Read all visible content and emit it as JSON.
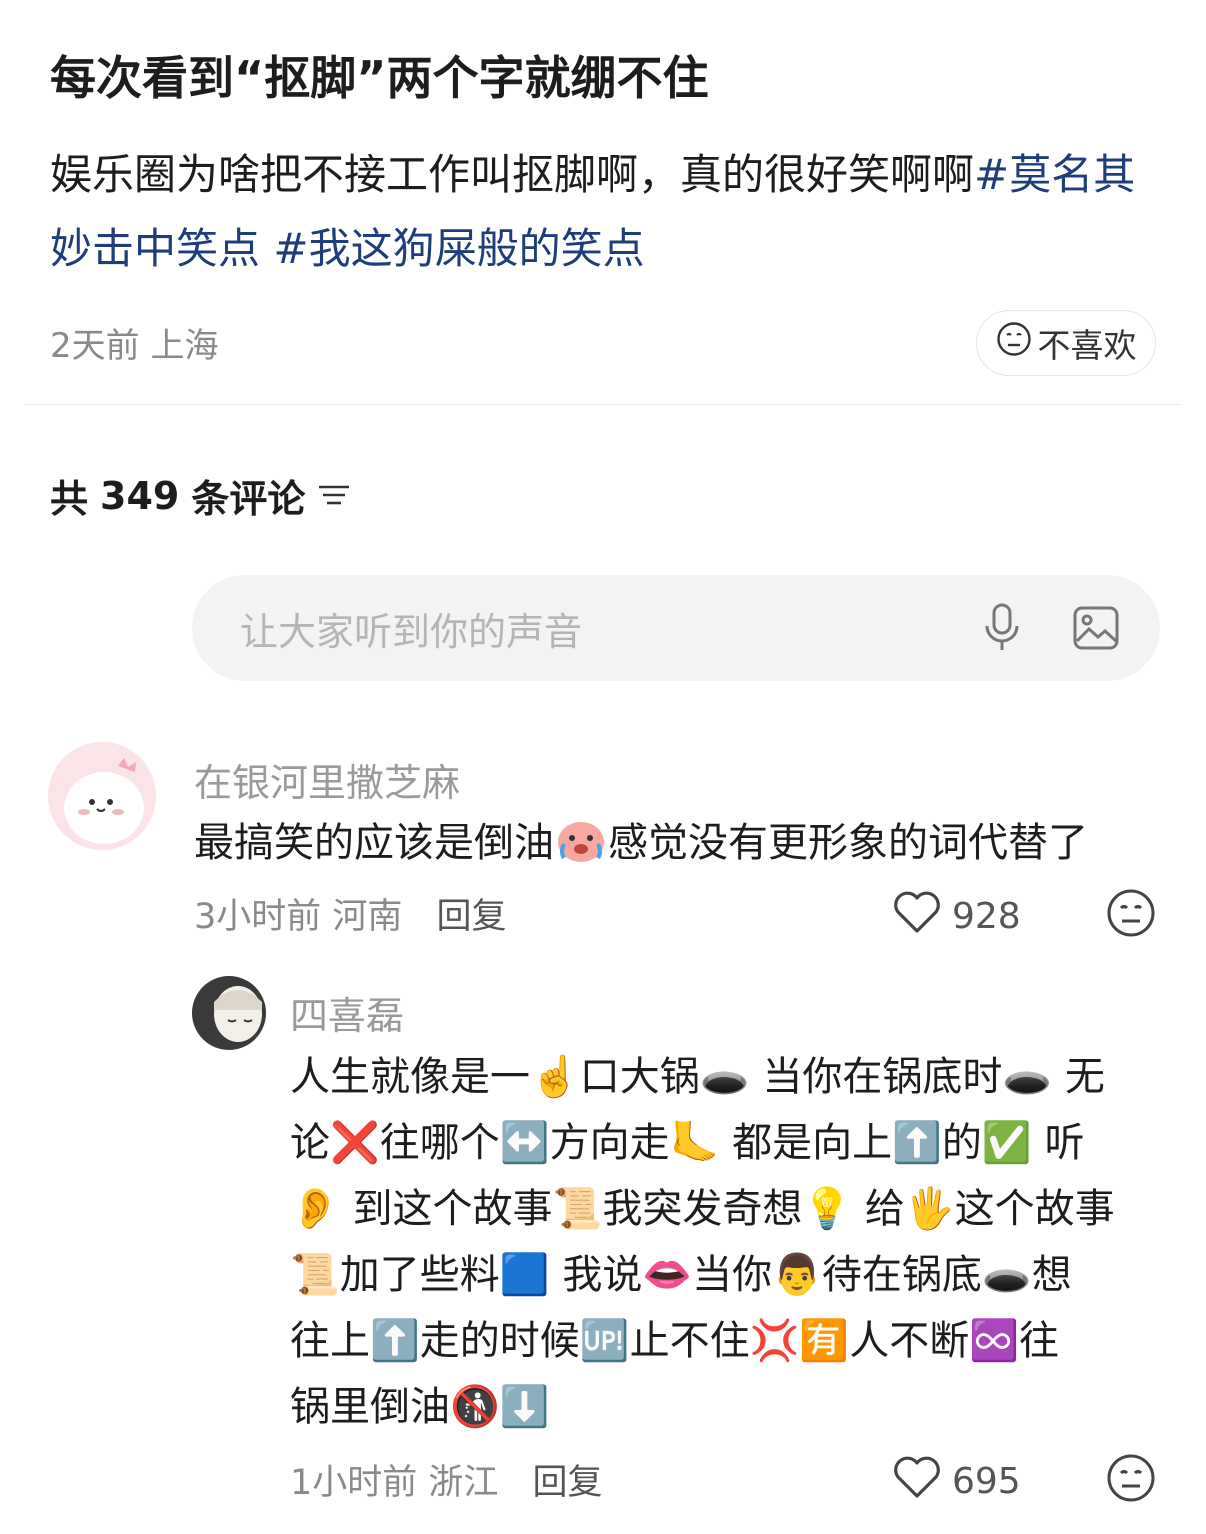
{
  "post": {
    "title": "每次看到“抠脚”两个字就绷不住",
    "body_text": "娱乐圈为啥把不接工作叫抠脚啊，真的很好笑啊啊",
    "tags": [
      "#莫名其妙击中笑点",
      "#我这狗屎般的笑点"
    ],
    "tag_prefix_hash": "#",
    "time": "2天前",
    "location": "上海",
    "dislike_label": "不喜欢"
  },
  "comments_header": {
    "prefix": "共",
    "count": "349",
    "suffix": "条评论"
  },
  "input": {
    "placeholder": "让大家听到你的声音"
  },
  "comments": [
    {
      "user": "在银河里撒芝麻",
      "text_part1": "最搞笑的应该是倒油",
      "text_part2": "感觉没有更形象的词代替了",
      "time": "3小时前",
      "location": "河南",
      "reply_label": "回复",
      "likes": "928"
    },
    {
      "user": "四喜磊",
      "lines": [
        "人生就像是一☝️口大锅🕳️ 当你在锅底时🕳️ 无",
        "论❌往哪个↔️方向走🦶 都是向上⬆️的✅ 听",
        "👂 到这个故事📜我突发奇想💡 给🖐️这个故事",
        "📜加了些料🟦 我说👄当你👨待在锅底🕳️想",
        "往上⬆️走的时候🆙止不住💢🈶人不断♾️往",
        "锅里倒油🚯⬇️"
      ],
      "time": "1小时前",
      "location": "浙江",
      "reply_label": "回复",
      "likes": "695"
    }
  ],
  "colors": {
    "tag": "#1f3d7a",
    "meta": "#8a8a8a",
    "input_bg": "#f3f3f5"
  }
}
